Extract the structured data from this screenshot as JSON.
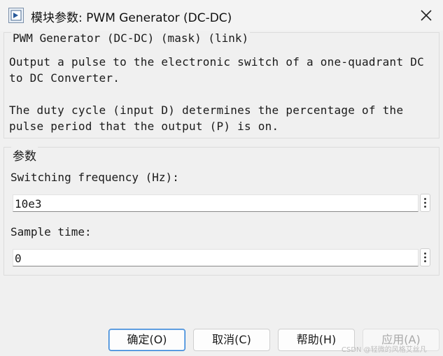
{
  "window": {
    "title": "模块参数: PWM Generator (DC-DC)",
    "app_icon": "simulink-block-icon",
    "close_icon": "close-icon"
  },
  "description": {
    "heading": "PWM Generator (DC-DC) (mask) (link)",
    "lines": [
      "Output a pulse to the electronic switch of a one-quadrant DC",
      "to DC Converter.",
      "",
      "The duty cycle (input D) determines the percentage of the",
      "pulse period that the output (P) is on."
    ]
  },
  "parameters": {
    "heading": "参数",
    "fields": [
      {
        "label": "Switching frequency (Hz):",
        "value": "10e3",
        "menu_icon": "kebab-menu-icon"
      },
      {
        "label": "Sample time:",
        "value": "0",
        "menu_icon": "kebab-menu-icon"
      }
    ]
  },
  "buttons": {
    "ok": "确定(O)",
    "cancel": "取消(C)",
    "help": "帮助(H)",
    "apply": "应用(A)"
  },
  "watermark": "CSDN @轻微的风格艾丝凡",
  "colors": {
    "primary_border": "#2f7fd3",
    "window_bg": "#f0f0f0",
    "disabled_text": "#a8a8a8"
  }
}
